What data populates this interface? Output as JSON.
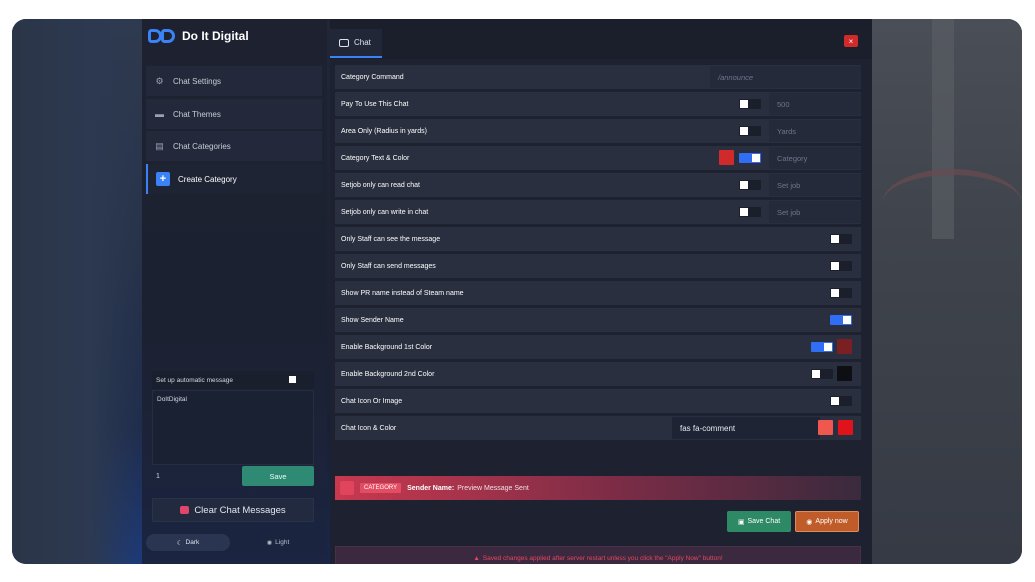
{
  "brand": {
    "name": "Do It Digital"
  },
  "sidebar": {
    "items": [
      {
        "label": "Chat Settings",
        "icon": "cogs-icon"
      },
      {
        "label": "Chat Themes",
        "icon": "window-icon"
      },
      {
        "label": "Chat Categories",
        "icon": "comments-icon"
      },
      {
        "label": "Create Category",
        "icon": "plus-icon",
        "active": true
      }
    ],
    "auto_message": {
      "label": "Set up automatic message",
      "enabled": false,
      "text": "DoItDigital",
      "interval": "1",
      "save_label": "Save"
    },
    "clear_label": "Clear Chat Messages",
    "theme": {
      "dark_label": "Dark",
      "light_label": "Light",
      "selected": "Dark"
    }
  },
  "header": {
    "tab_label": "Chat",
    "close_label": "×"
  },
  "form": {
    "rows": [
      {
        "label": "Category Command",
        "placeholder": "/announce"
      },
      {
        "label": "Pay To Use This Chat",
        "toggle": false,
        "placeholder": "500"
      },
      {
        "label": "Area Only (Radius in yards)",
        "toggle": false,
        "placeholder": "Yards"
      },
      {
        "label": "Category Text & Color",
        "toggle": true,
        "color": "#d12a2a",
        "placeholder": "Category"
      },
      {
        "label": "Setjob only can read chat",
        "toggle": false,
        "placeholder": "Set job"
      },
      {
        "label": "Setjob only can write in chat",
        "toggle": false,
        "placeholder": "Set job"
      },
      {
        "label": "Only Staff can see the message",
        "toggle": false
      },
      {
        "label": "Only Staff can send messages",
        "toggle": false
      },
      {
        "label": "Show PR name instead of Steam name",
        "toggle": false
      },
      {
        "label": "Show Sender Name",
        "toggle": true
      },
      {
        "label": "Enable Background 1st Color",
        "toggle": true,
        "color": "#7a1f22"
      },
      {
        "label": "Enable Background 2nd Color",
        "toggle": false,
        "color": "#0d0f13"
      },
      {
        "label": "Chat Icon Or Image",
        "toggle": false
      },
      {
        "label": "Chat Icon & Color",
        "icon_value": "fas fa-comment",
        "color1": "#f0584f",
        "color2": "#e0131b"
      }
    ]
  },
  "preview": {
    "badge": "CATEGORY",
    "sender": "Sender Name:",
    "message": "Preview Message Sent"
  },
  "actions": {
    "save_label": "Save Chat",
    "apply_label": "Apply now"
  },
  "notice": "Saved changes applied after server restart unless you click the \"Apply Now\" button!"
}
